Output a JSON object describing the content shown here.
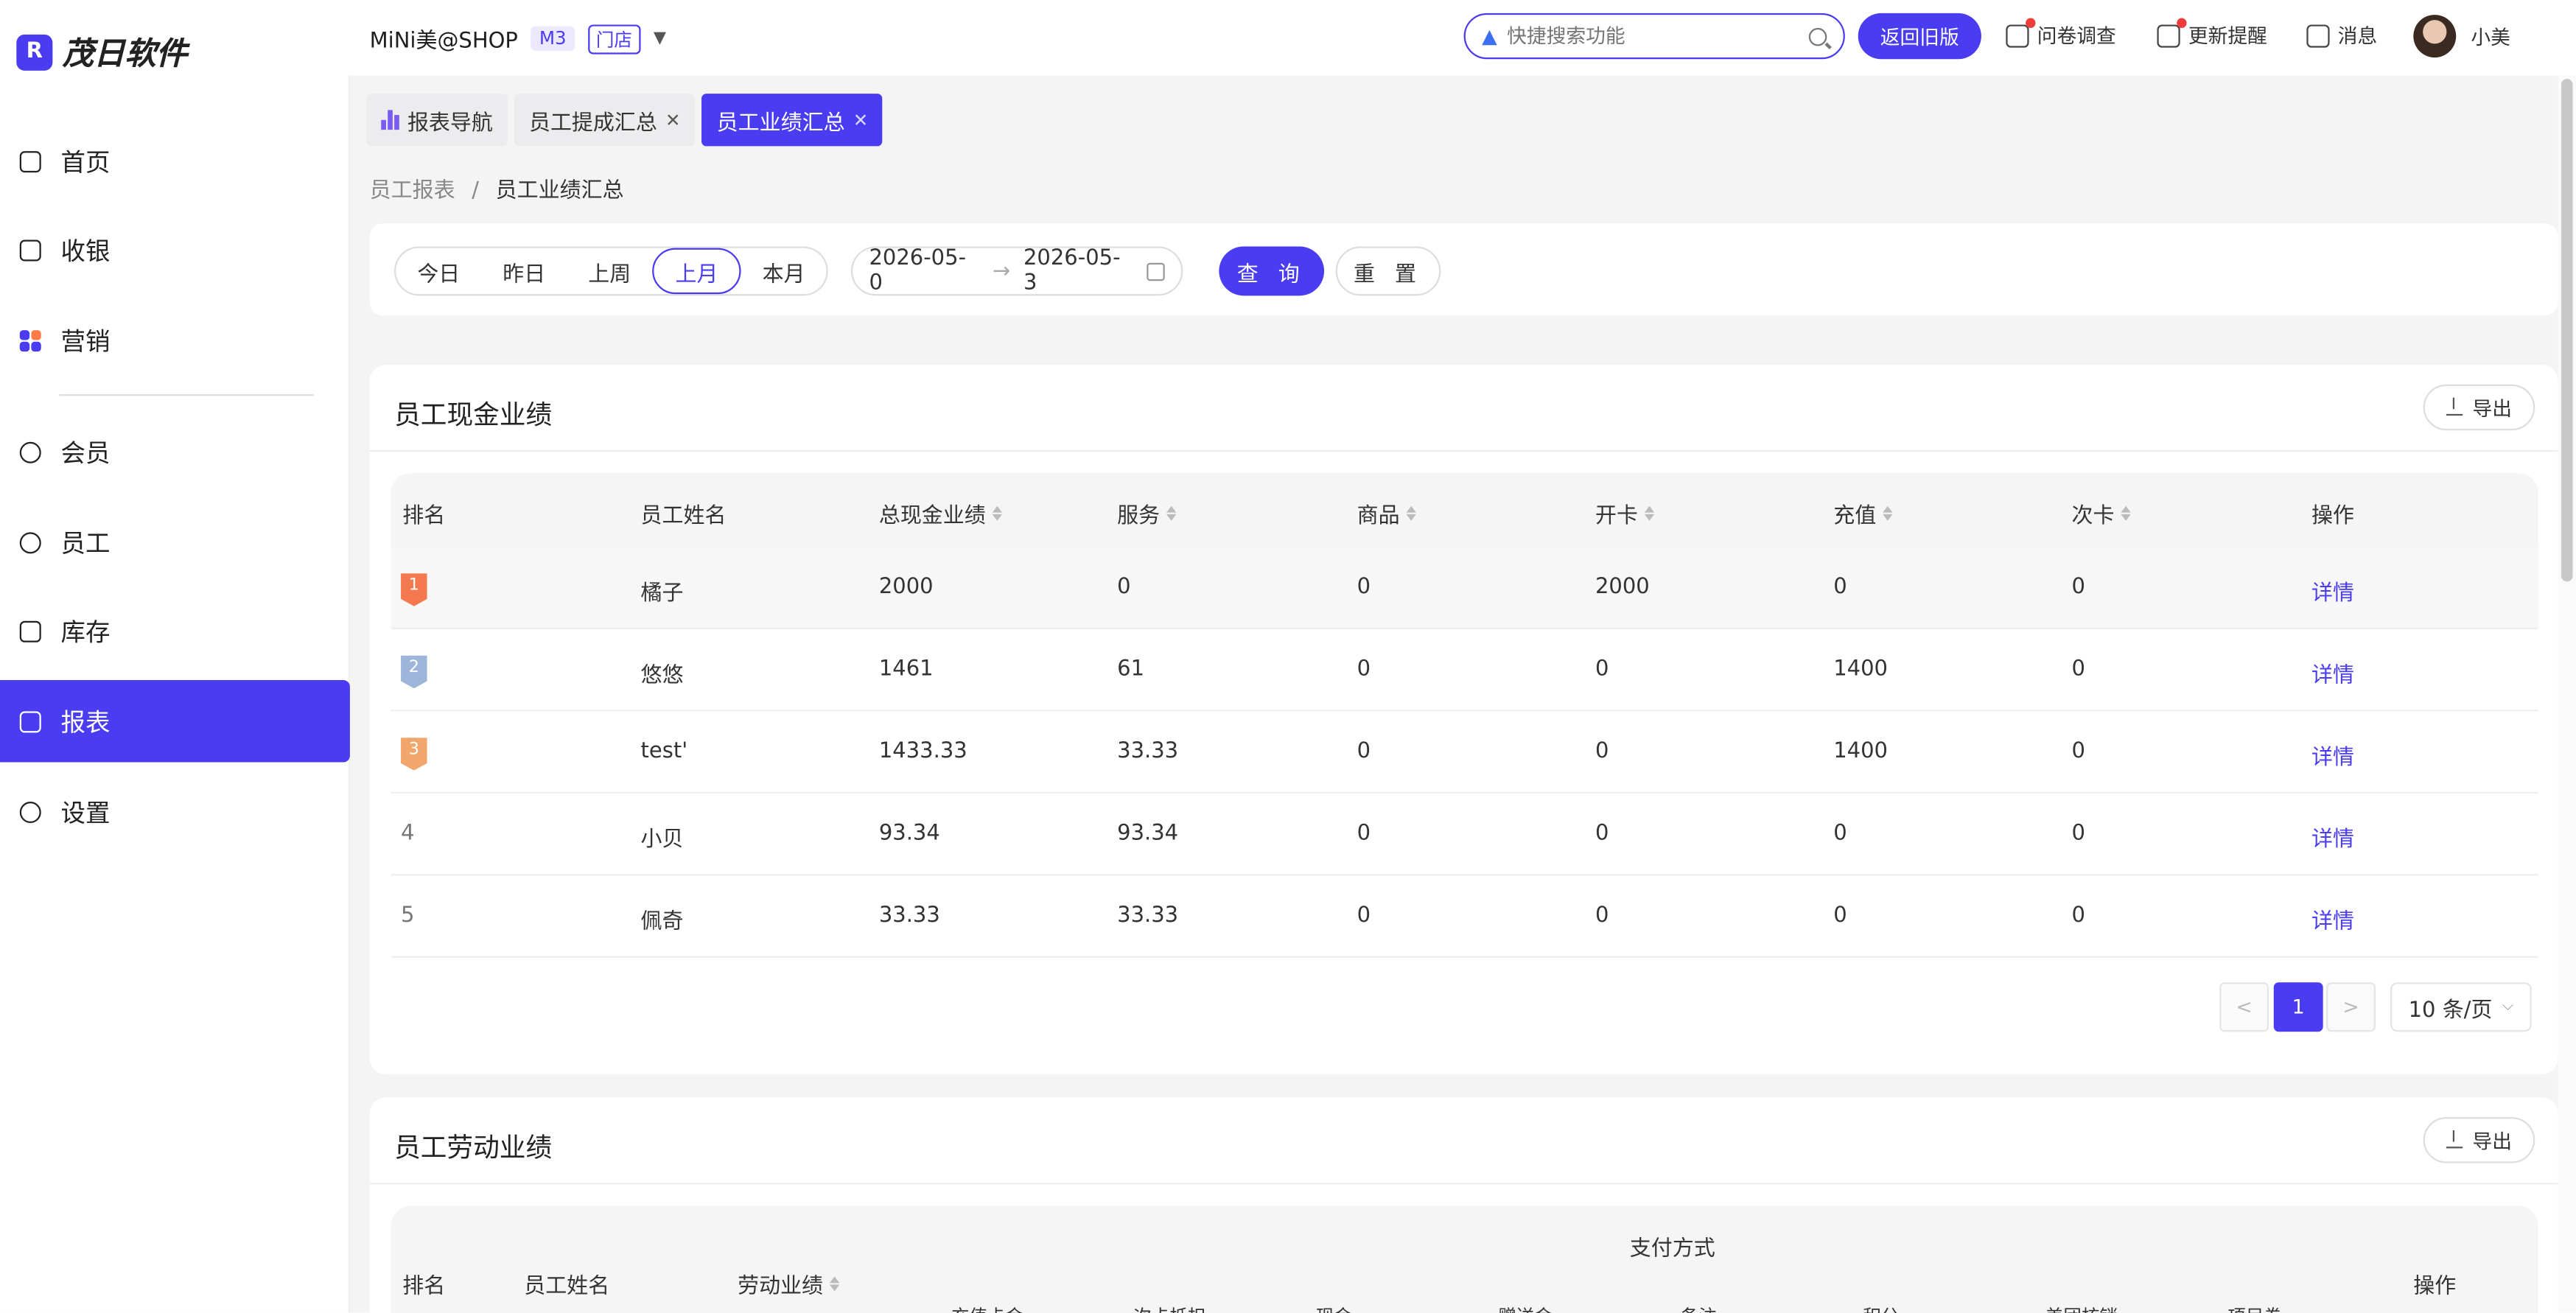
{
  "brand": {
    "name": "茂日软件",
    "mark": "R"
  },
  "shop": {
    "name": "MiNi美@SHOP",
    "level": "M3",
    "type": "门店"
  },
  "search": {
    "placeholder": "快捷搜索功能"
  },
  "header": {
    "back_label": "返回旧版",
    "survey_label": "问卷调查",
    "update_label": "更新提醒",
    "message_label": "消息",
    "user_name": "小美"
  },
  "sidebar": {
    "items": [
      {
        "label": "首页"
      },
      {
        "label": "收银"
      },
      {
        "label": "营销"
      },
      {
        "label": "会员"
      },
      {
        "label": "员工"
      },
      {
        "label": "库存"
      },
      {
        "label": "报表"
      },
      {
        "label": "设置"
      }
    ],
    "active": "报表"
  },
  "tabs": [
    {
      "label": "报表导航"
    },
    {
      "label": "员工提成汇总"
    },
    {
      "label": "员工业绩汇总"
    }
  ],
  "breadcrumb": {
    "parent": "员工报表",
    "separator": "/",
    "current": "员工业绩汇总"
  },
  "filter": {
    "periods": [
      "今日",
      "昨日",
      "上周",
      "上月",
      "本月"
    ],
    "active_period": "上月",
    "date_start": "2026-05-0",
    "date_end": "2026-05-3",
    "query_label": "查 询",
    "reset_label": "重 置"
  },
  "cash_card": {
    "title": "员工现金业绩",
    "export_label": "导出",
    "columns": [
      "排名",
      "员工姓名",
      "总现金业绩",
      "服务",
      "商品",
      "开卡",
      "充值",
      "次卡",
      "操作"
    ],
    "rows": [
      {
        "rank": "1",
        "name": "橘子",
        "total": "2000",
        "service": "0",
        "goods": "0",
        "card_open": "2000",
        "recharge": "0",
        "times_card": "0",
        "action": "详情"
      },
      {
        "rank": "2",
        "name": "悠悠",
        "total": "1461",
        "service": "61",
        "goods": "0",
        "card_open": "0",
        "recharge": "1400",
        "times_card": "0",
        "action": "详情"
      },
      {
        "rank": "3",
        "name": "test'",
        "total": "1433.33",
        "service": "33.33",
        "goods": "0",
        "card_open": "0",
        "recharge": "1400",
        "times_card": "0",
        "action": "详情"
      },
      {
        "rank": "4",
        "name": "小贝",
        "total": "93.34",
        "service": "93.34",
        "goods": "0",
        "card_open": "0",
        "recharge": "0",
        "times_card": "0",
        "action": "详情"
      },
      {
        "rank": "5",
        "name": "佩奇",
        "total": "33.33",
        "service": "33.33",
        "goods": "0",
        "card_open": "0",
        "recharge": "0",
        "times_card": "0",
        "action": "详情"
      }
    ],
    "pagination": {
      "current": "1",
      "prev": "<",
      "next": ">",
      "page_size": "10 条/页"
    }
  },
  "labor_card": {
    "title": "员工劳动业绩",
    "export_label": "导出",
    "columns": [
      "排名",
      "员工姓名",
      "劳动业绩",
      "支付方式",
      "操作"
    ],
    "sub_columns": [
      "充值卡金",
      "次卡抵扣",
      "现金",
      "赠送金",
      "备注",
      "积分",
      "美团核销",
      "项目卷"
    ]
  },
  "colors": {
    "accent": "#4a3cf0",
    "rank1": "#f5794f",
    "rank2": "#9db5d8",
    "rank3": "#f2a66b"
  }
}
